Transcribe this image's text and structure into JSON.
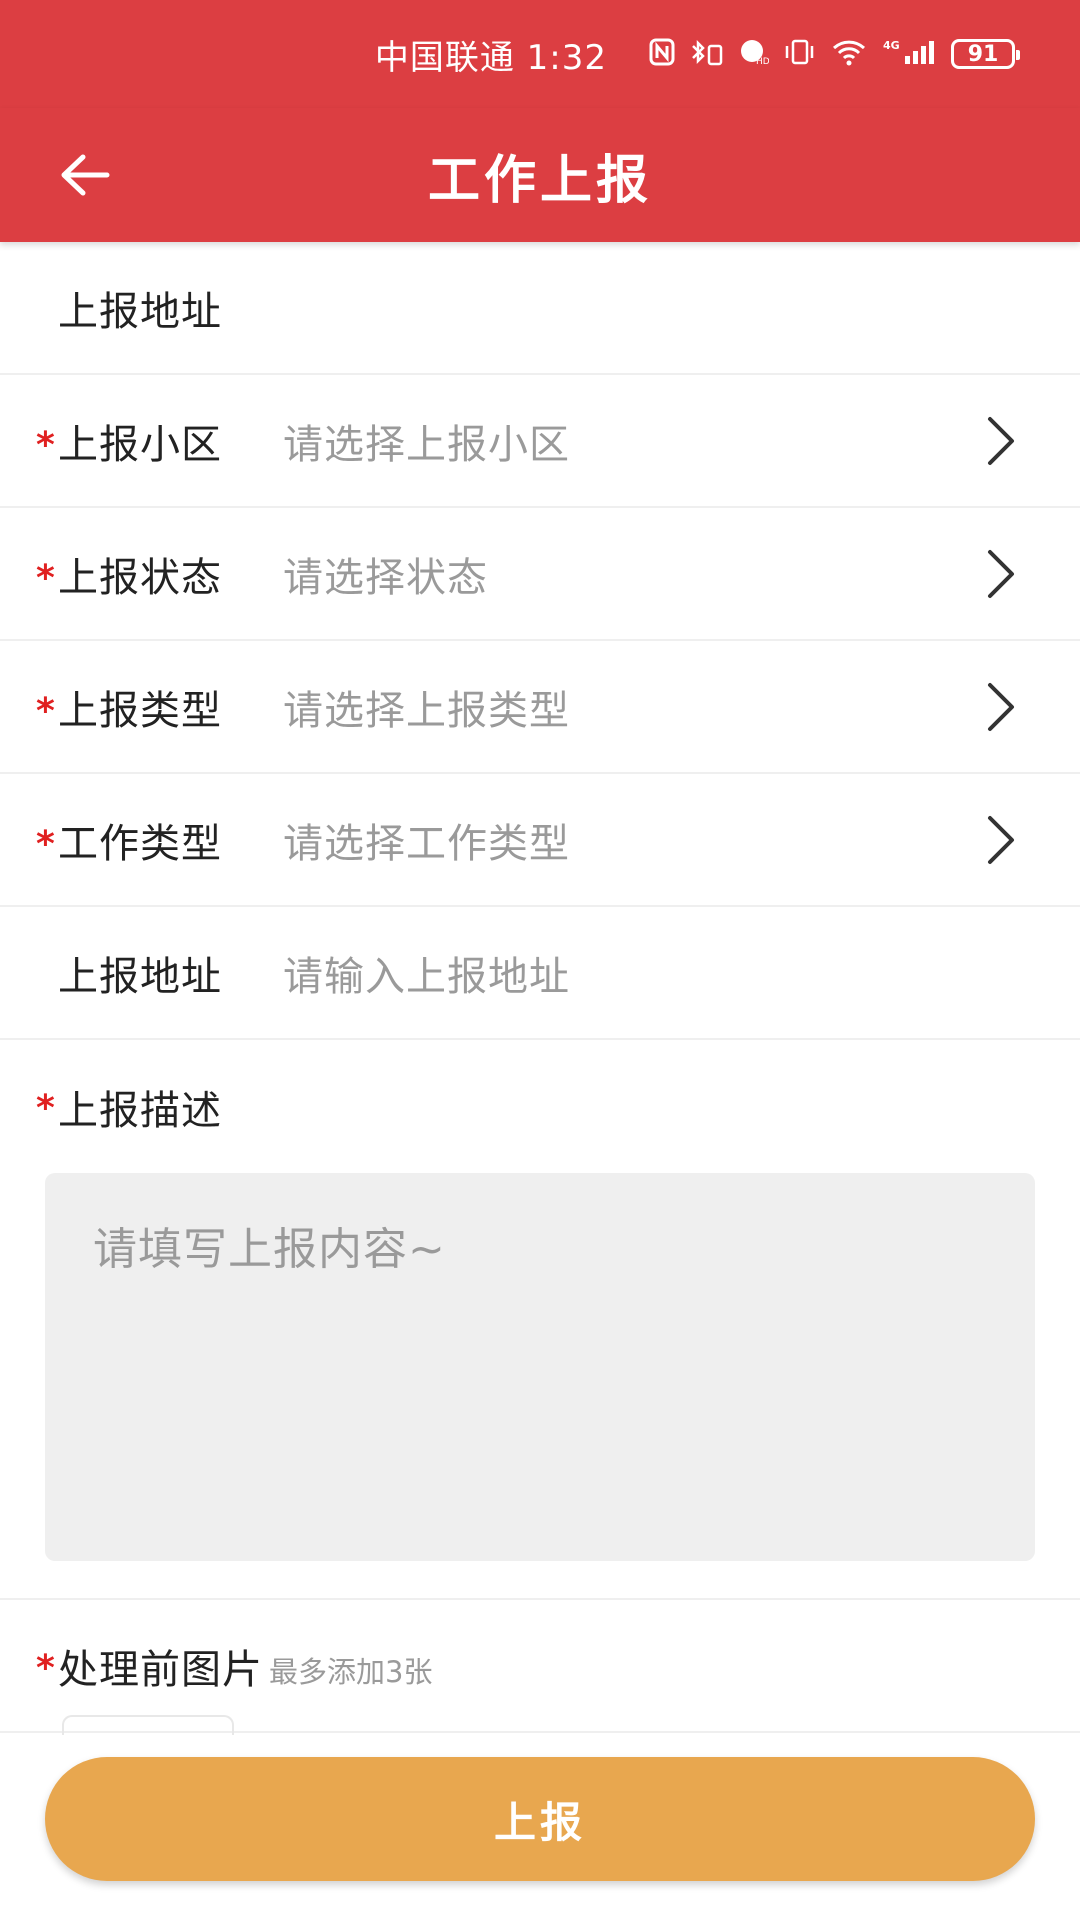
{
  "status_bar": {
    "carrier": "中国联通",
    "time": "1:32",
    "network": "4G",
    "battery": "91",
    "icons": [
      "nfc-icon",
      "bluetooth-icon",
      "hd-icon",
      "vibrate-icon",
      "wifi-icon",
      "signal-icon",
      "battery-icon"
    ]
  },
  "app_bar": {
    "title": "工作上报"
  },
  "form": {
    "header_label": "上报地址",
    "rows": [
      {
        "required": "*",
        "label": "上报小区",
        "placeholder": "请选择上报小区"
      },
      {
        "required": "*",
        "label": "上报状态",
        "placeholder": "请选择状态"
      },
      {
        "required": "*",
        "label": "上报类型",
        "placeholder": "请选择上报类型"
      },
      {
        "required": "*",
        "label": "工作类型",
        "placeholder": "请选择工作类型"
      }
    ],
    "address": {
      "label": "上报地址",
      "placeholder": "请输入上报地址"
    },
    "description": {
      "required": "*",
      "label": "上报描述",
      "placeholder": "请填写上报内容~"
    },
    "photos": {
      "required": "*",
      "label": "处理前图片",
      "hint": "最多添加3张"
    }
  },
  "submit": {
    "label": "上报"
  },
  "colors": {
    "header": "#dc3e42",
    "required": "#e02020",
    "submit": "#e8a74f",
    "placeholder": "#9a9a9a"
  }
}
